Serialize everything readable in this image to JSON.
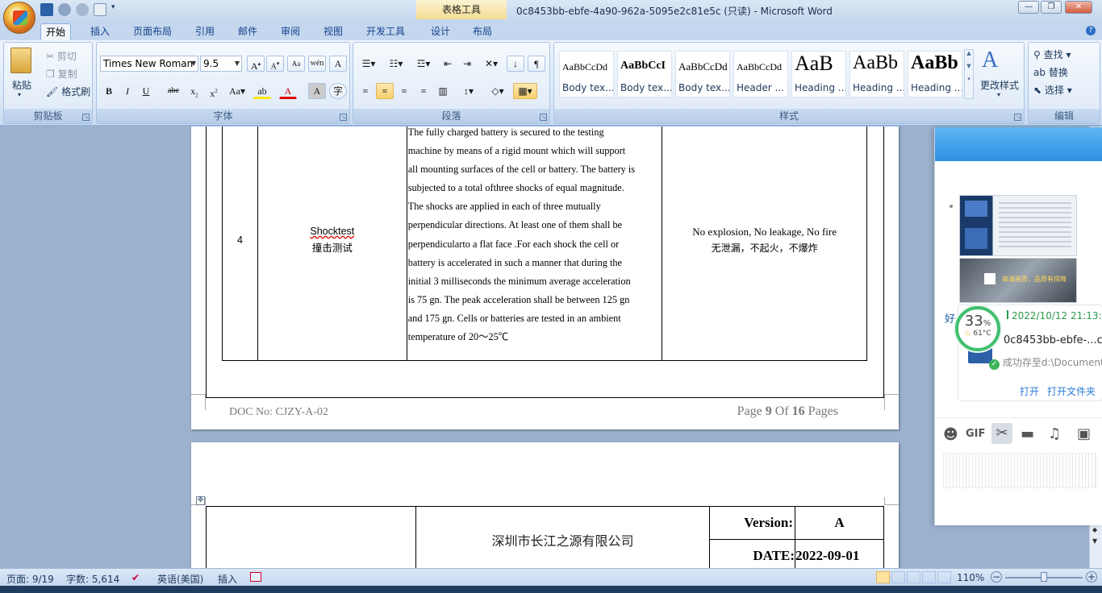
{
  "window": {
    "context_tab": "表格工具",
    "title": "0c8453bb-ebfe-4a90-962a-5095e2c81e5c (只读) - Microsoft Word"
  },
  "tabs": [
    "开始",
    "插入",
    "页面布局",
    "引用",
    "邮件",
    "审阅",
    "视图",
    "开发工具",
    "设计",
    "布局"
  ],
  "clipboard": {
    "paste": "粘贴",
    "cut": "剪切",
    "copy": "复制",
    "format_painter": "格式刷",
    "group": "剪贴板"
  },
  "font": {
    "name": "Times New Roman",
    "size": "9.5",
    "group": "字体"
  },
  "paragraph": {
    "group": "段落"
  },
  "styles": {
    "items": [
      {
        "sample": "AaBbCcDd",
        "name": "Body tex..."
      },
      {
        "sample": "AaBbCcI",
        "name": "Body tex..."
      },
      {
        "sample": "AaBbCcDd",
        "name": "Body tex..."
      },
      {
        "sample": "AaBbCcDd",
        "name": "Header ..."
      },
      {
        "sample": "AaB",
        "name": "Heading ..."
      },
      {
        "sample": "AaBb",
        "name": "Heading ..."
      },
      {
        "sample": "AaBb",
        "name": "Heading ..."
      }
    ],
    "change": "更改样式",
    "group": "样式"
  },
  "editing": {
    "find": "查找",
    "replace": "替换",
    "select": "选择",
    "group": "编辑"
  },
  "document": {
    "row_number": "4",
    "test_name_en": "Shocktest",
    "test_name_cn": "撞击测试",
    "procedure_lines": [
      "The fully charged battery is secured to the testing",
      "machine by means of a rigid mount which will support",
      "all mounting surfaces of the cell or battery. The battery is",
      "subjected to a total ofthree shocks of equal magnitude.",
      "The shocks are applied in each of three mutually",
      "perpendicular directions. At least one of them shall be",
      "perpendicularto a flat face .For each shock the cell or",
      "battery is accelerated in such a manner that during the",
      "initial 3 milliseconds the minimum average acceleration",
      "is 75 gn. The peak acceleration shall be between 125 gn",
      "and 175 gn. Cells or batteries are tested in an ambient",
      "temperature of 20～25℃"
    ],
    "criteria_en": "No explosion, No leakage, No fire",
    "criteria_cn": "无泄漏，不起火，不爆炸",
    "footer_doc_no": "DOC No: CJZY-A-02",
    "footer_page_prefix": "Page ",
    "footer_page_num": "9",
    "footer_page_of": " Of ",
    "footer_page_total": "16",
    "footer_page_suffix": " Pages",
    "company": "深圳市长江之源有限公司",
    "version_label": "Version:",
    "version_value": "A",
    "date_label": "DATE:",
    "date_value": "2022-09-01"
  },
  "side_panel": {
    "timestamp": "2022/10/12 21:13:1",
    "filename": "0c8453bb-ebfe-...c.c",
    "saved_to": "成功存至d:\\Document",
    "open": "打开",
    "open_folder": "打开文件夹",
    "label_left": "好",
    "cpu_percent": "33",
    "cpu_unit": "%",
    "temperature": "61°C",
    "promo_text": "高清画质，品质有保障"
  },
  "statusbar": {
    "page": "页面: 9/19",
    "words": "字数: 5,614",
    "language": "英语(美国)",
    "mode": "插入",
    "zoom": "110%"
  }
}
